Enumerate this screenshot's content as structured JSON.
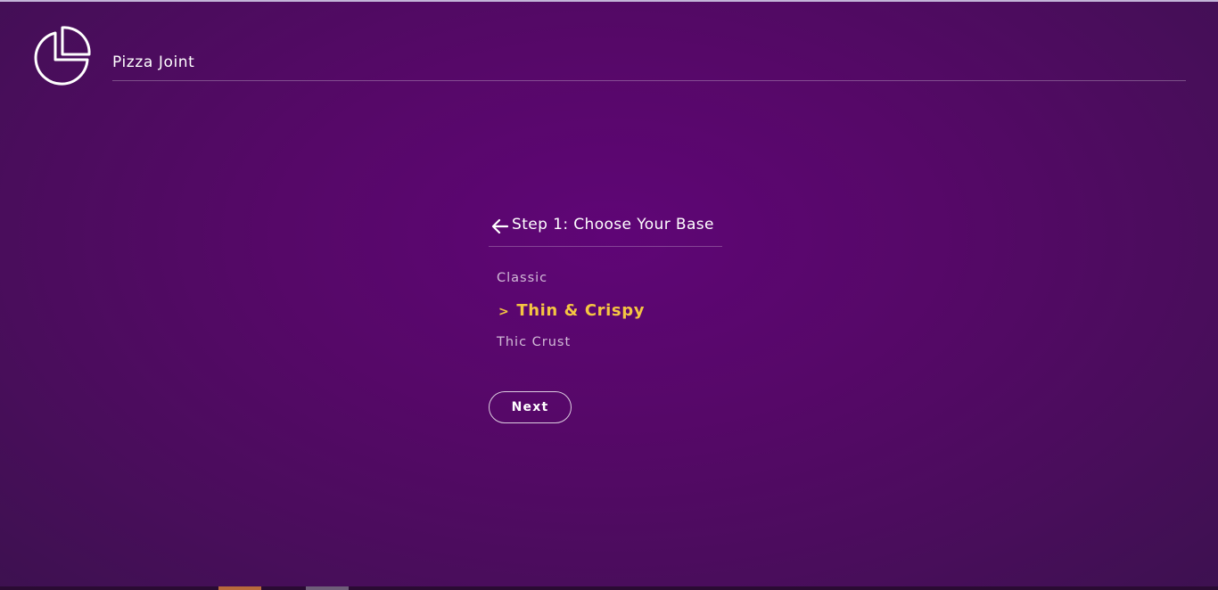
{
  "app": {
    "brand": "Pizza Joint",
    "logo_icon": "pie-chart-icon"
  },
  "step": {
    "title": "Step 1: Choose Your Base",
    "back_icon": "arrow-left-icon",
    "options": [
      {
        "label": "Classic",
        "selected": false
      },
      {
        "label": "Thin & Crispy",
        "selected": true
      },
      {
        "label": "Thic Crust",
        "selected": false
      }
    ],
    "selected_marker": ">",
    "next_label": "Next"
  },
  "colors": {
    "background": "#5f0576",
    "accent": "#f5c542",
    "text": "#ffffff"
  }
}
